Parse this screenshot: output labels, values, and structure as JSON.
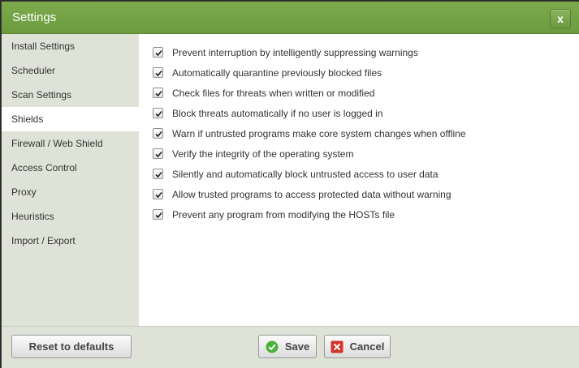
{
  "window": {
    "title": "Settings",
    "close_label": "x"
  },
  "sidebar": {
    "items": [
      {
        "label": "Install Settings",
        "active": false
      },
      {
        "label": "Scheduler",
        "active": false
      },
      {
        "label": "Scan Settings",
        "active": false
      },
      {
        "label": "Shields",
        "active": true
      },
      {
        "label": "Firewall / Web Shield",
        "active": false
      },
      {
        "label": "Access Control",
        "active": false
      },
      {
        "label": "Proxy",
        "active": false
      },
      {
        "label": "Heuristics",
        "active": false
      },
      {
        "label": "Import / Export",
        "active": false
      }
    ]
  },
  "options": [
    {
      "label": "Prevent interruption by intelligently suppressing warnings",
      "checked": true
    },
    {
      "label": "Automatically quarantine previously blocked files",
      "checked": true
    },
    {
      "label": "Check files for threats when written or modified",
      "checked": true
    },
    {
      "label": "Block threats automatically if no user is logged in",
      "checked": true
    },
    {
      "label": "Warn if untrusted programs make core system changes when offline",
      "checked": true
    },
    {
      "label": "Verify the integrity of the operating system",
      "checked": true
    },
    {
      "label": "Silently and automatically block untrusted access to user data",
      "checked": true
    },
    {
      "label": "Allow trusted programs to access protected data without warning",
      "checked": true
    },
    {
      "label": "Prevent any program from modifying the HOSTs file",
      "checked": true
    }
  ],
  "footer": {
    "reset_label": "Reset to defaults",
    "save_label": "Save",
    "cancel_label": "Cancel"
  },
  "colors": {
    "titlebar": "#73a244",
    "sidebar_bg": "#dfe3d7",
    "save_icon": "#4caf3a",
    "cancel_icon": "#d0342c"
  },
  "icons": {
    "save": "checkmark-circle-icon",
    "cancel": "x-square-icon",
    "checkbox": "checkmark-icon"
  }
}
